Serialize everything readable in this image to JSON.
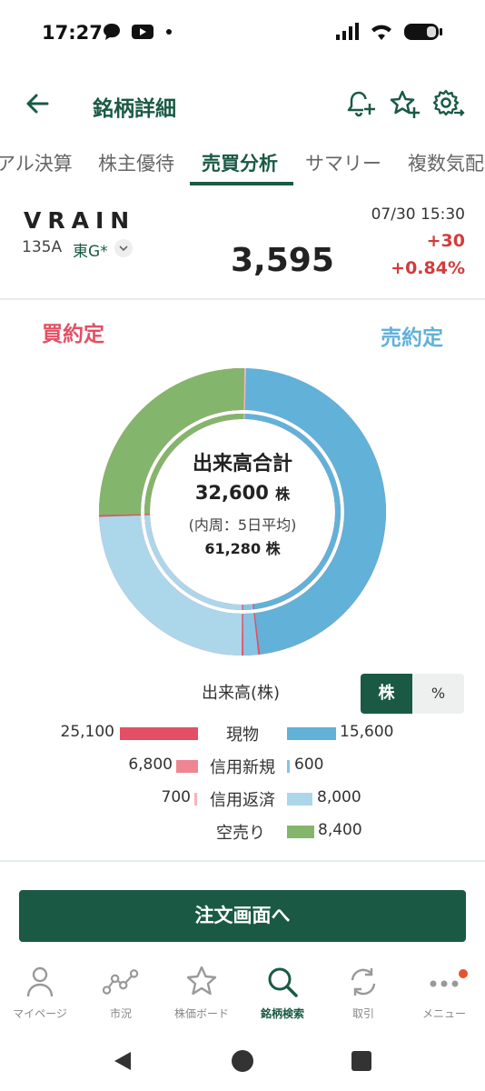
{
  "status_bar": {
    "time": "17:27"
  },
  "header": {
    "title": "銘柄詳細"
  },
  "tabs": [
    {
      "label": "アル決算"
    },
    {
      "label": "株主優待"
    },
    {
      "label": "売買分析"
    },
    {
      "label": "サマリー"
    },
    {
      "label": "複数気配"
    }
  ],
  "stock": {
    "name": "VRAIN",
    "code": "135A",
    "market": "東G*",
    "price": "3,595",
    "datetime": "07/30 15:30",
    "change": "+30",
    "change_pct": "+0.84%"
  },
  "analysis": {
    "buy_title": "買約定",
    "sell_title": "売約定",
    "center_title": "出来高合計",
    "total": "32,600",
    "total_unit": "株",
    "sub_label": "(内周：5日平均)",
    "avg": "61,280",
    "avg_unit": "株",
    "volume_label": "出来高(株)",
    "toggle": {
      "shares": "株",
      "percent": "%"
    },
    "legend": [
      {
        "name": "現物",
        "buy": "25,100",
        "sell": "15,600"
      },
      {
        "name": "信用新規",
        "buy": "6,800",
        "sell": "600"
      },
      {
        "name": "信用返済",
        "buy": "700",
        "sell": "8,000"
      },
      {
        "name": "空売り",
        "buy": "",
        "sell": "8,400"
      }
    ],
    "colors": {
      "buy_spot": "#e34f64",
      "buy_margin_new": "#ef8593",
      "buy_margin_repay": "#f4b4bd",
      "sell_spot": "#62b1d9",
      "sell_margin_new": "#86c4e3",
      "sell_margin_repay": "#acd6ea",
      "short": "#84b56c"
    }
  },
  "order_button": "注文画面へ",
  "bottom_nav": [
    {
      "label": "マイページ",
      "icon": "person-icon"
    },
    {
      "label": "市況",
      "icon": "market-chart-icon"
    },
    {
      "label": "株価ボード",
      "icon": "star-icon"
    },
    {
      "label": "銘柄検索",
      "icon": "search-icon"
    },
    {
      "label": "取引",
      "icon": "refresh-icon"
    },
    {
      "label": "メニュー",
      "icon": "more-dots-icon"
    }
  ]
}
